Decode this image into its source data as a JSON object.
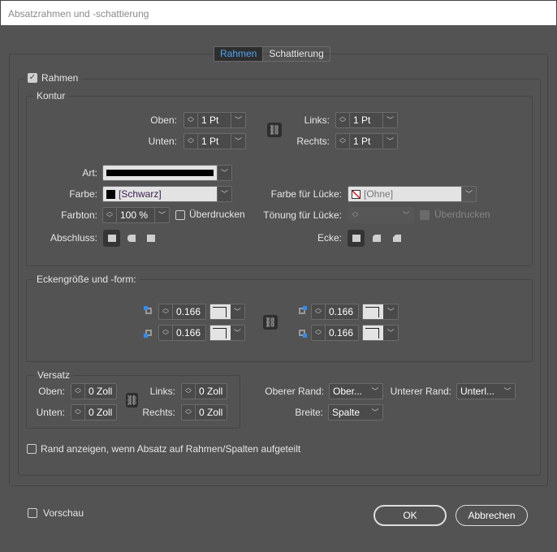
{
  "window": {
    "title": "Absatzrahmen und -schattierung"
  },
  "tabs": [
    {
      "label": "Rahmen",
      "active": true
    },
    {
      "label": "Schattierung",
      "active": false
    }
  ],
  "rahmen": {
    "label": "Rahmen",
    "checked": true
  },
  "kontur": {
    "legend": "Kontur",
    "oben": {
      "label": "Oben:",
      "value": "1 Pt"
    },
    "unten": {
      "label": "Unten:",
      "value": "1 Pt"
    },
    "links": {
      "label": "Links:",
      "value": "1 Pt"
    },
    "rechts": {
      "label": "Rechts:",
      "value": "1 Pt"
    },
    "art": {
      "label": "Art:"
    },
    "farbe": {
      "label": "Farbe:",
      "value": "[Schwarz]"
    },
    "farbton": {
      "label": "Farbton:",
      "value": "100 %"
    },
    "ueberdrucken": {
      "label": "Überdrucken",
      "checked": false
    },
    "abschluss": {
      "label": "Abschluss:"
    },
    "farbe_luecke": {
      "label": "Farbe für Lücke:",
      "value": "[Ohne]"
    },
    "toenung_luecke": {
      "label": "Tönung für Lücke:",
      "value": ""
    },
    "ueberdrucken_luecke": {
      "label": "Überdrucken",
      "disabled": true
    },
    "ecke": {
      "label": "Ecke:"
    }
  },
  "eckengroesse": {
    "legend": "Eckengröße und -form:",
    "top_left": "0.166",
    "bottom_left": "0.166",
    "top_right": "0.166",
    "bottom_right": "0.166"
  },
  "versatz": {
    "legend": "Versatz",
    "oben": {
      "label": "Oben:",
      "value": "0 Zoll"
    },
    "unten": {
      "label": "Unten:",
      "value": "0 Zoll"
    },
    "links": {
      "label": "Links:",
      "value": "0 Zoll"
    },
    "rechts": {
      "label": "Rechts:",
      "value": "0 Zoll"
    }
  },
  "oberer_rand": {
    "label": "Oberer Rand:",
    "value": "Ober..."
  },
  "unterer_rand": {
    "label": "Unterer Rand:",
    "value": "Unterl..."
  },
  "breite": {
    "label": "Breite:",
    "value": "Spalte"
  },
  "rand_anzeigen": {
    "label": "Rand anzeigen, wenn Absatz auf Rahmen/Spalten aufgeteilt",
    "checked": false
  },
  "vorschau": {
    "label": "Vorschau",
    "checked": false
  },
  "buttons": {
    "ok": "OK",
    "cancel": "Abbrechen"
  },
  "colors": {
    "accent": "#4fa3f0",
    "background": "#535353"
  }
}
